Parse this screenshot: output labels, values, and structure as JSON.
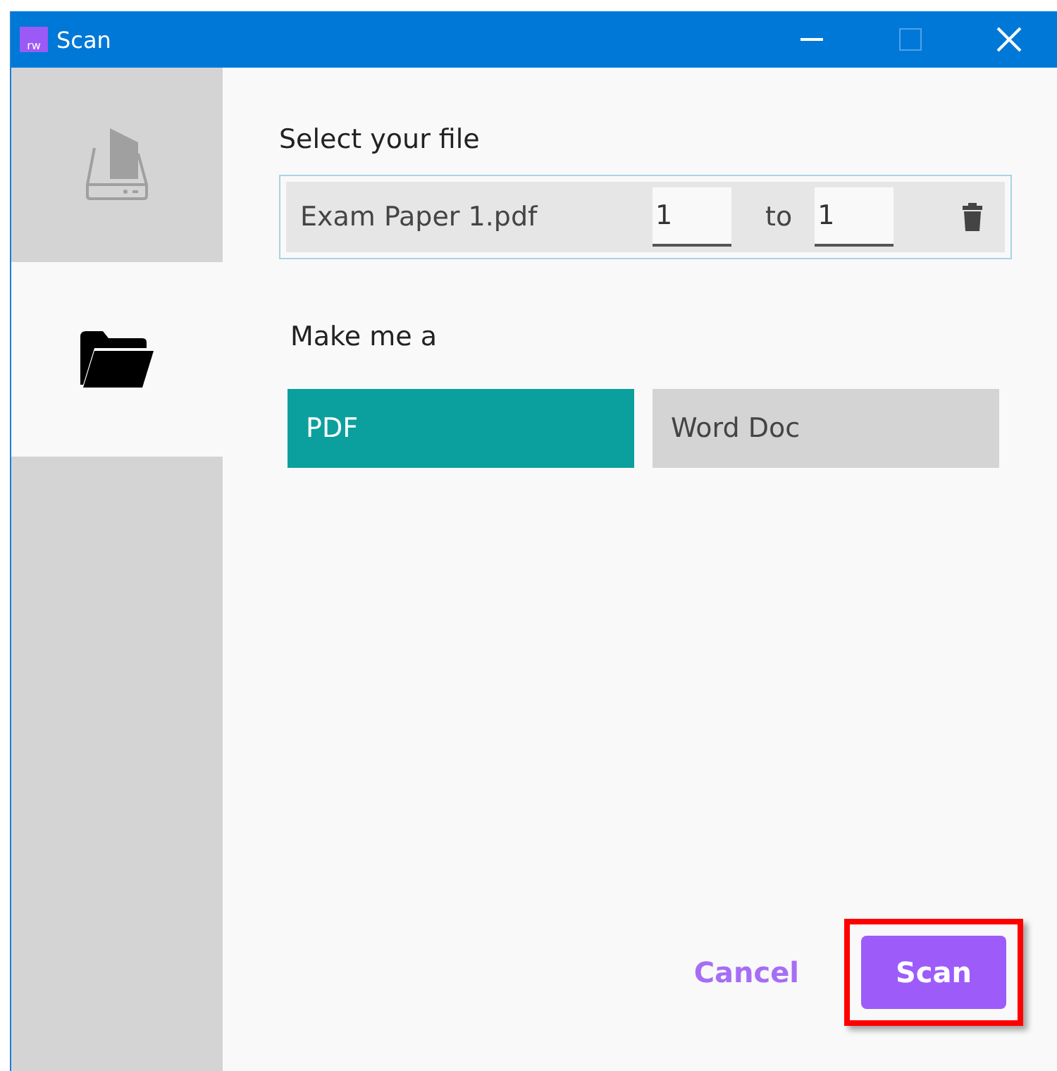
{
  "window": {
    "app_icon_text": "rw",
    "title": "Scan"
  },
  "sidebar": {
    "items": [
      {
        "kind": "scanner",
        "selected": false
      },
      {
        "kind": "folder",
        "selected": true
      }
    ]
  },
  "file_section": {
    "label": "Select your file",
    "file": {
      "name": "Exam Paper 1.pdf",
      "from": "1",
      "separator": "to",
      "to": "1"
    }
  },
  "format_section": {
    "label": "Make me a",
    "options": [
      {
        "label": "PDF",
        "selected": true
      },
      {
        "label": "Word Doc",
        "selected": false
      }
    ]
  },
  "actions": {
    "cancel": "Cancel",
    "scan": {
      "label": "Scan",
      "highlighted": true
    }
  }
}
